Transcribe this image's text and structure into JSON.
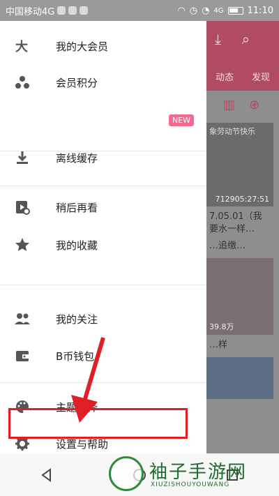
{
  "status_bar": {
    "carrier": "中国移动4G",
    "network": "4G",
    "time": "11:10"
  },
  "drawer": {
    "items": [
      {
        "label": "我的大会员",
        "icon": "vip-icon"
      },
      {
        "label": "会员积分",
        "icon": "points-icon"
      },
      {
        "label": "离线缓存",
        "icon": "download-icon"
      },
      {
        "label": "稍后再看",
        "icon": "watch-later-icon"
      },
      {
        "label": "我的收藏",
        "icon": "star-icon"
      },
      {
        "label": "我的关注",
        "icon": "people-icon"
      },
      {
        "label": "B币钱包",
        "icon": "wallet-icon"
      },
      {
        "label": "主题选择",
        "icon": "palette-icon"
      },
      {
        "label": "设置与帮助",
        "icon": "gear-icon"
      }
    ],
    "new_badge": "NEW"
  },
  "background_app": {
    "tabs": [
      "动态",
      "发现"
    ],
    "card1_caption": "象劳动节快乐",
    "card1_meta": "712905:27:51",
    "card1_title": "7.05.01（我\n要水一样…",
    "card1_sub": "…追缴…",
    "card2_meta": "39.8万",
    "card2_title": "…样"
  },
  "watermark": {
    "title": "袖子手游网",
    "subtitle": "XIUZISHOUYOUWANG"
  },
  "colors": {
    "accent": "#e01e26",
    "brand": "#b14b63",
    "badge": "#f06b8f"
  }
}
